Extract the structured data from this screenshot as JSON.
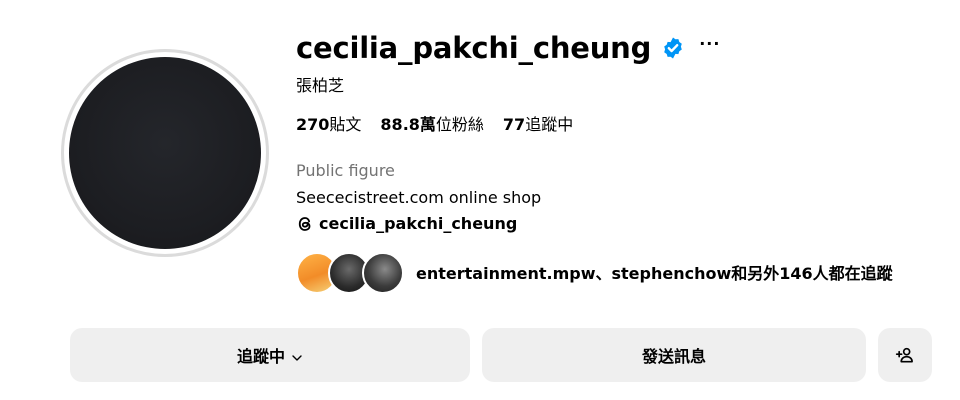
{
  "profile": {
    "username": "cecilia_pakchi_cheung",
    "full_name": "張柏芝",
    "verified": true,
    "more_options_label": "···",
    "category": "Public figure",
    "bio": "Seececistreet.com online shop",
    "threads_handle": "cecilia_pakchi_cheung"
  },
  "stats": {
    "posts_value": "270",
    "posts_label": "貼文",
    "followers_value": "88.8萬",
    "followers_label": "位粉絲",
    "following_value": "77",
    "following_label": "追蹤中"
  },
  "followed_by": {
    "text": "entertainment.mpw、stephenchow和另外146人都在追蹤"
  },
  "actions": {
    "following_label": "追蹤中",
    "message_label": "發送訊息"
  },
  "icons": {
    "verified": "verified-badge-icon",
    "threads": "threads-icon",
    "chevron": "chevron-down-icon",
    "suggest": "add-person-icon"
  },
  "colors": {
    "verified_blue": "#0095f6",
    "button_bg": "#efefef",
    "secondary_text": "#737373"
  }
}
